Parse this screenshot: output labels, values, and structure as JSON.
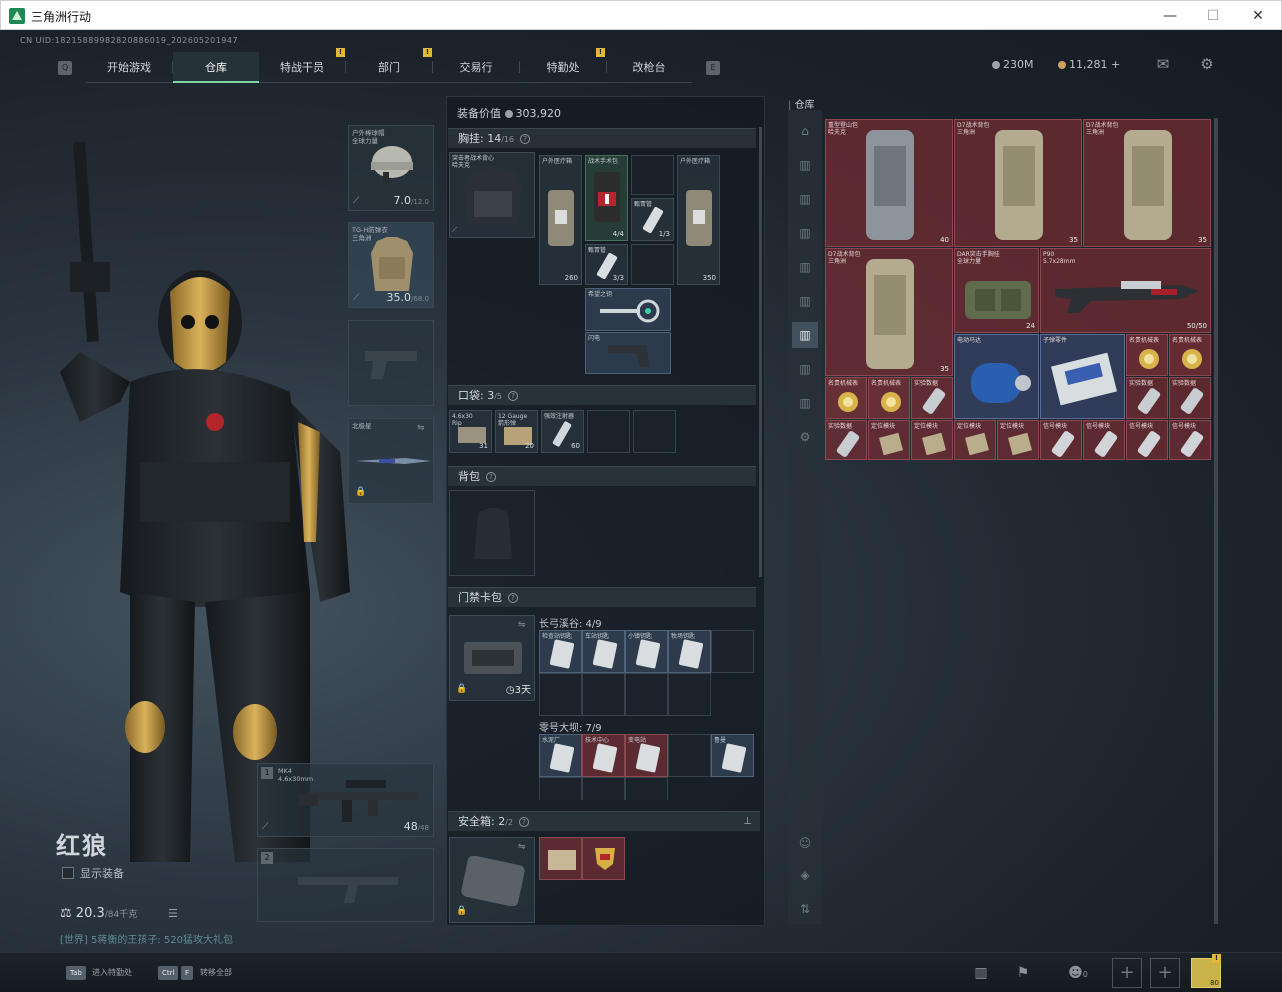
{
  "window": {
    "title": "三角洲行动",
    "min": "—",
    "max": "☐",
    "close": "✕"
  },
  "uid": "CN UID:18215889982820886019_202605201947",
  "nav": {
    "left_key": "Q",
    "right_key": "E",
    "tabs": [
      "开始游戏",
      "仓库",
      "特战干员",
      "部门",
      "交易行",
      "特勤处",
      "改枪台"
    ],
    "active": 1
  },
  "currency": {
    "silver": "230M",
    "gold": "11,281 +"
  },
  "operator": {
    "name": "红狼",
    "show_equipment": "显示装备",
    "weight": "20.3",
    "weight_max": "/84千克",
    "promo": "[世界] 5蒋衡的王孩子: 520猛攻大礼包",
    "helmet": {
      "name": "户外棒球帽\n全球力量",
      "value": "7.0",
      "max": "/12.0"
    },
    "armor": {
      "name": "TG-H防弹衣\n三角洲",
      "value": "35.0",
      "max": "/68.0"
    },
    "melee": {
      "name": "北极星"
    },
    "primary": {
      "slot": "1",
      "name": "MK4\n4.6x30mm",
      "value": "48",
      "max": "/48"
    },
    "secondary": {
      "slot": "2"
    }
  },
  "loadout": {
    "value_label": "装备价值",
    "value": "303,920",
    "chest": {
      "label": "胸挂:",
      "count": "14",
      "max": "/16",
      "rig_name": "突击者战术背心\n哈夫克",
      "items": [
        {
          "name": "户外医疗箱",
          "qty": "260"
        },
        {
          "name": "战术手术包",
          "qty": "4/4"
        },
        {
          "name": "甄胃管",
          "qty": "1/3"
        },
        {
          "name": "户外医疗箱",
          "qty": "350"
        },
        {
          "name": "甄胃管",
          "qty": "3/3"
        },
        {
          "name": "希望之钥",
          "qty": ""
        },
        {
          "name": "闪电",
          "qty": ""
        }
      ]
    },
    "pocket": {
      "label": "口袋:",
      "count": "3",
      "max": "/5",
      "items": [
        {
          "name": "4.6x30\nRip",
          "qty": "31"
        },
        {
          "name": "12 Gauge\n箭形弹",
          "qty": "20"
        },
        {
          "name": "强效注射器",
          "qty": "60"
        }
      ]
    },
    "backpack": {
      "label": "背包"
    },
    "keycard": {
      "label": "门禁卡包",
      "time": "3天",
      "maps": [
        {
          "name": "长弓溪谷: 4/9",
          "cards": [
            "检查站钥匙",
            "车站钥匙",
            "小镇钥匙",
            "牧场钥匙"
          ]
        },
        {
          "name": "零号大坝: 7/9",
          "cards": [
            "水泥厂",
            "技术中心",
            "变电站",
            "鲁曼"
          ]
        }
      ]
    },
    "safe": {
      "label": "安全箱:",
      "count": "2",
      "max": "/2",
      "pin": "⊥"
    }
  },
  "storage": {
    "title": "仓库",
    "items": [
      {
        "name": "重型登山包\n哈夫克",
        "qty": "40"
      },
      {
        "name": "D7战术背包\n三角洲",
        "qty": "35"
      },
      {
        "name": "D7战术背包\n三角洲",
        "qty": "35"
      },
      {
        "name": "D7战术背包\n三角洲",
        "qty": "35"
      },
      {
        "name": "DAR突击手胸挂\n全球力量",
        "qty": "24"
      },
      {
        "name": "P90\n5.7x28mm",
        "qty": "50/50"
      },
      {
        "name": "电动马达",
        "qty": ""
      },
      {
        "name": "子弹零件",
        "qty": ""
      },
      {
        "name": "名贵机械表",
        "qty": ""
      },
      {
        "name": "名贵机械表",
        "qty": ""
      },
      {
        "name": "名贵机械表",
        "qty": ""
      },
      {
        "name": "名贵机械表",
        "qty": ""
      },
      {
        "name": "实验数据",
        "qty": ""
      },
      {
        "name": "实验数据",
        "qty": ""
      },
      {
        "name": "实验数据",
        "qty": ""
      },
      {
        "name": "实验数据",
        "qty": ""
      },
      {
        "name": "定位模块",
        "qty": ""
      },
      {
        "name": "定位模块",
        "qty": ""
      },
      {
        "name": "定位模块",
        "qty": ""
      },
      {
        "name": "定位模块",
        "qty": ""
      },
      {
        "name": "信号模块",
        "qty": ""
      },
      {
        "name": "信号模块",
        "qty": ""
      },
      {
        "name": "信号模块",
        "qty": ""
      },
      {
        "name": "信号模块",
        "qty": ""
      }
    ]
  },
  "bottom": {
    "k1": "Tab",
    "l1": "进入特勤处",
    "k2": "Ctrl",
    "k3": "F",
    "l2": "转移全部",
    "friends": "0",
    "avatar_lv": "80"
  }
}
